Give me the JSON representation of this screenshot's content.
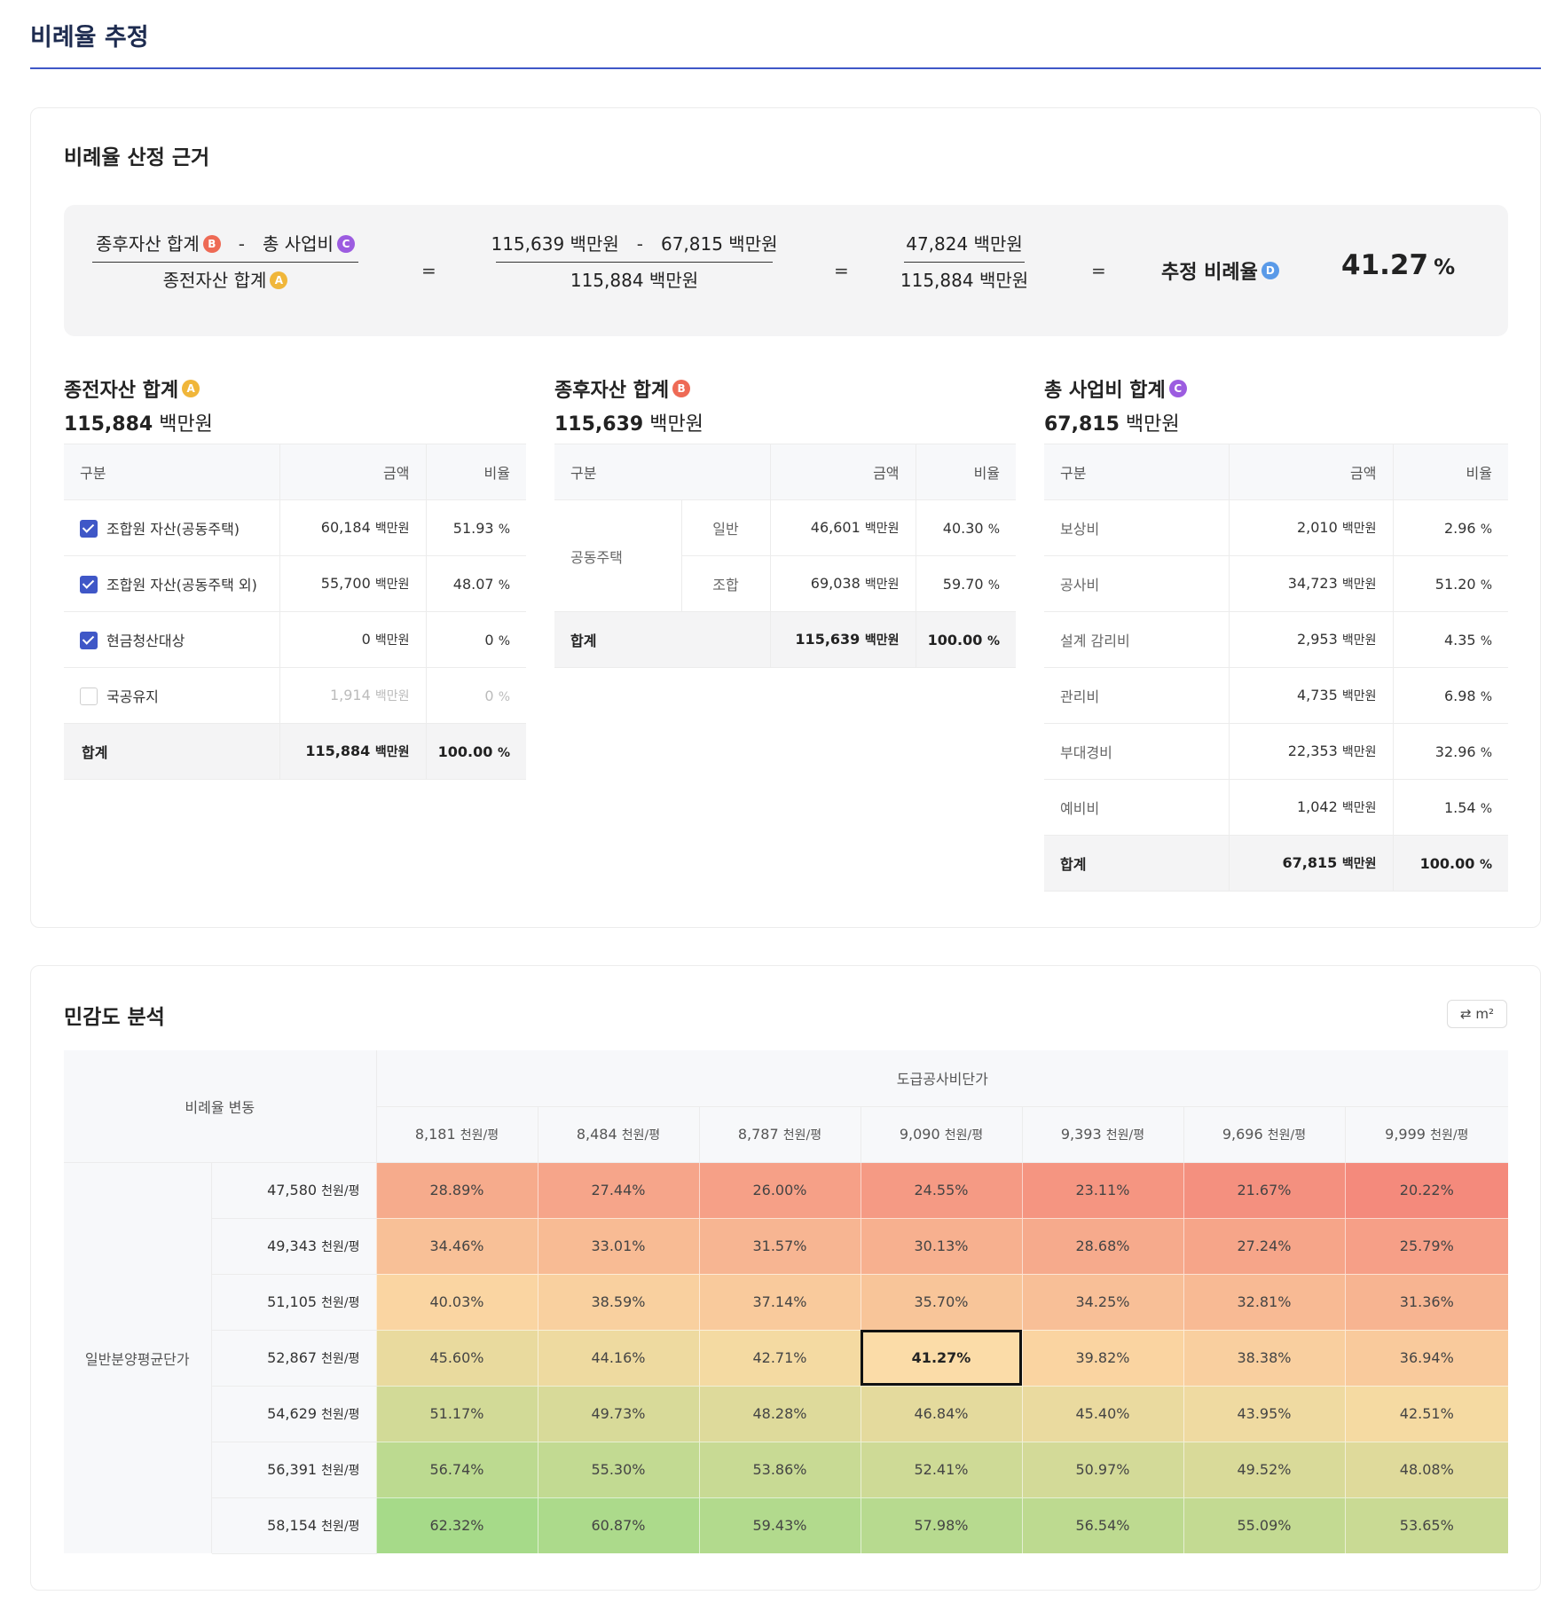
{
  "page_title": "비례율 추정",
  "basis": {
    "title": "비례율 산정 근거",
    "formula": {
      "term_after": "종후자산 합계",
      "term_cost": "총 사업비",
      "term_before": "종전자산 합계",
      "badge_a": "A",
      "badge_b": "B",
      "badge_c": "C",
      "badge_d": "D",
      "minus": "-",
      "equals": "=",
      "num_after": "115,639 백만원",
      "num_cost": "67,815 백만원",
      "den_before": "115,884 백만원",
      "diff": "47,824 백만원",
      "den_before2": "115,884 백만원",
      "result_label": "추정 비례율",
      "result_value": "41.27",
      "result_unit": "%"
    },
    "before": {
      "title": "종전자산 합계",
      "value": "115,884",
      "unit": "백만원",
      "headers": [
        "구분",
        "금액",
        "비율"
      ],
      "rows": [
        {
          "label": "조합원 자산(공동주택)",
          "amount": "60,184",
          "unit": "백만원",
          "ratio": "51.93",
          "pct": "%",
          "checked": true
        },
        {
          "label": "조합원 자산(공동주택 외)",
          "amount": "55,700",
          "unit": "백만원",
          "ratio": "48.07",
          "pct": "%",
          "checked": true
        },
        {
          "label": "현금청산대상",
          "amount": "0",
          "unit": "백만원",
          "ratio": "0",
          "pct": "%",
          "checked": true
        },
        {
          "label": "국공유지",
          "amount": "1,914",
          "unit": "백만원",
          "ratio": "0",
          "pct": "%",
          "checked": false
        }
      ],
      "total": {
        "label": "합계",
        "amount": "115,884",
        "unit": "백만원",
        "ratio": "100.00",
        "pct": "%"
      }
    },
    "after": {
      "title": "종후자산 합계",
      "value": "115,639",
      "unit": "백만원",
      "headers": [
        "구분",
        "금액",
        "비율"
      ],
      "group": "공동주택",
      "rows": [
        {
          "label": "일반",
          "amount": "46,601",
          "unit": "백만원",
          "ratio": "40.30",
          "pct": "%"
        },
        {
          "label": "조합",
          "amount": "69,038",
          "unit": "백만원",
          "ratio": "59.70",
          "pct": "%"
        }
      ],
      "total": {
        "label": "합계",
        "amount": "115,639",
        "unit": "백만원",
        "ratio": "100.00",
        "pct": "%"
      }
    },
    "cost": {
      "title": "총 사업비 합계",
      "value": "67,815",
      "unit": "백만원",
      "headers": [
        "구분",
        "금액",
        "비율"
      ],
      "rows": [
        {
          "label": "보상비",
          "amount": "2,010",
          "unit": "백만원",
          "ratio": "2.96",
          "pct": "%"
        },
        {
          "label": "공사비",
          "amount": "34,723",
          "unit": "백만원",
          "ratio": "51.20",
          "pct": "%"
        },
        {
          "label": "설계 감리비",
          "amount": "2,953",
          "unit": "백만원",
          "ratio": "4.35",
          "pct": "%"
        },
        {
          "label": "관리비",
          "amount": "4,735",
          "unit": "백만원",
          "ratio": "6.98",
          "pct": "%"
        },
        {
          "label": "부대경비",
          "amount": "22,353",
          "unit": "백만원",
          "ratio": "32.96",
          "pct": "%"
        },
        {
          "label": "예비비",
          "amount": "1,042",
          "unit": "백만원",
          "ratio": "1.54",
          "pct": "%"
        }
      ],
      "total": {
        "label": "합계",
        "amount": "67,815",
        "unit": "백만원",
        "ratio": "100.00",
        "pct": "%"
      }
    }
  },
  "sensitivity": {
    "title": "민감도 분석",
    "unit_toggle": "⇄ m²",
    "corner_label": "비례율 변동",
    "col_group_label": "도급공사비단가",
    "row_group_label": "일반분양평균단가",
    "unit": "천원/평",
    "columns": [
      "8,181",
      "8,484",
      "8,787",
      "9,090",
      "9,393",
      "9,696",
      "9,999"
    ],
    "rows": [
      "47,580",
      "49,343",
      "51,105",
      "52,867",
      "54,629",
      "56,391",
      "58,154"
    ],
    "values": [
      [
        "28.89%",
        "27.44%",
        "26.00%",
        "24.55%",
        "23.11%",
        "21.67%",
        "20.22%"
      ],
      [
        "34.46%",
        "33.01%",
        "31.57%",
        "30.13%",
        "28.68%",
        "27.24%",
        "25.79%"
      ],
      [
        "40.03%",
        "38.59%",
        "37.14%",
        "35.70%",
        "34.25%",
        "32.81%",
        "31.36%"
      ],
      [
        "45.60%",
        "44.16%",
        "42.71%",
        "41.27%",
        "39.82%",
        "38.38%",
        "36.94%"
      ],
      [
        "51.17%",
        "49.73%",
        "48.28%",
        "46.84%",
        "45.40%",
        "43.95%",
        "42.51%"
      ],
      [
        "56.74%",
        "55.30%",
        "53.86%",
        "52.41%",
        "50.97%",
        "49.52%",
        "48.08%"
      ],
      [
        "62.32%",
        "60.87%",
        "59.43%",
        "57.98%",
        "56.54%",
        "55.09%",
        "53.65%"
      ]
    ],
    "highlight": {
      "row": 3,
      "col": 3
    }
  }
}
